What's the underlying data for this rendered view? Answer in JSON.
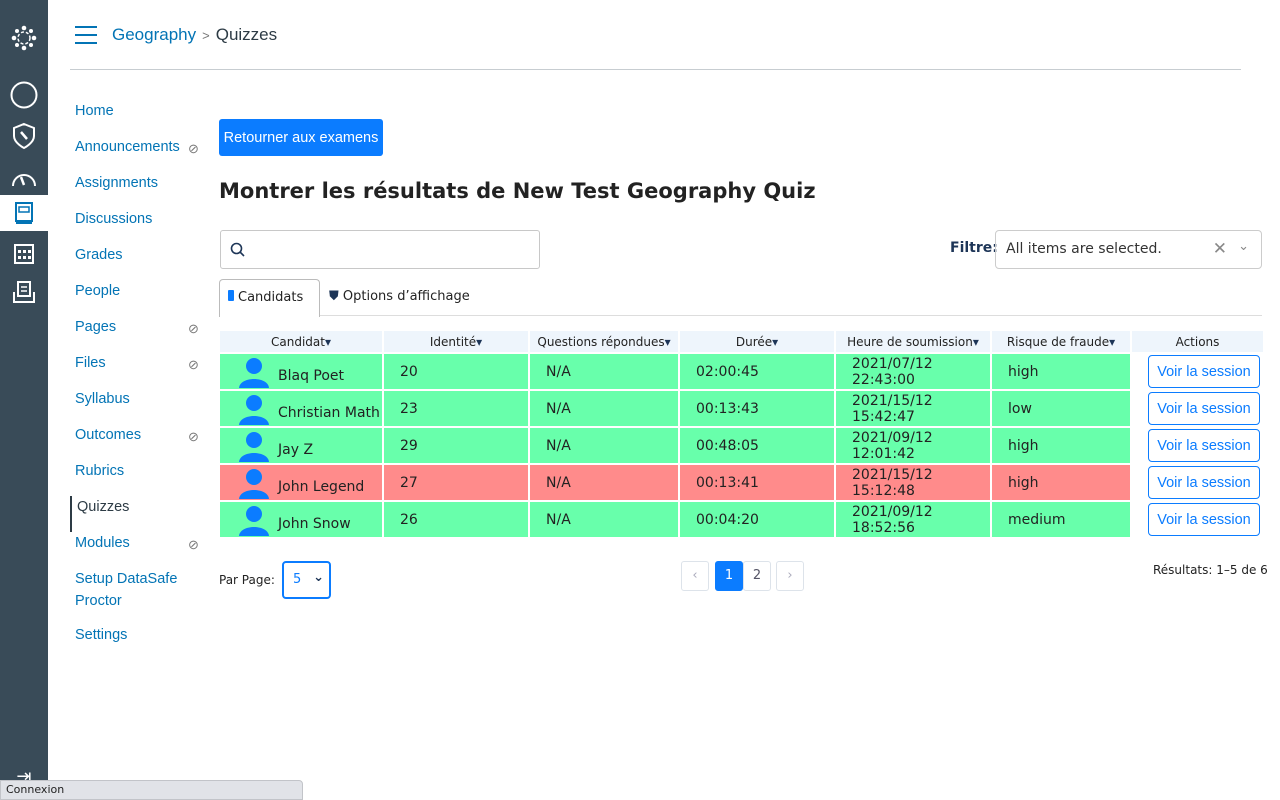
{
  "breadcrumb": {
    "course": "Geography",
    "page": "Quizzes"
  },
  "nav": [
    "Home",
    "Announcements",
    "Assignments",
    "Discussions",
    "Grades",
    "People",
    "Pages",
    "Files",
    "Syllabus",
    "Outcomes",
    "Rubrics",
    "Quizzes",
    "Modules",
    "Setup DataSafe Proctor",
    "Settings"
  ],
  "nav_hidden": [
    "Announcements",
    "Pages",
    "Files",
    "Outcomes",
    "Modules"
  ],
  "nav_current": "Quizzes",
  "back_button": "Retourner aux examens",
  "title": "Montrer les résultats de New Test Geography Quiz",
  "search": {
    "value": "",
    "placeholder": ""
  },
  "filter": {
    "label": "Filtre:",
    "value": "All items are selected."
  },
  "tabs": [
    "Candidats",
    "Options d’affichage"
  ],
  "table": {
    "headers": [
      "Candidat",
      "Identité",
      "Questions répondues",
      "Durée",
      "Heure de soumission",
      "Risque de fraude",
      "Actions"
    ],
    "action_label": "Voir la session",
    "rows": [
      {
        "name": "Blaq Poet",
        "id": "20",
        "questions": "N/A",
        "duration": "02:00:45",
        "submitted": "2021/07/12 22:43:00",
        "risk": "high",
        "flagged": false
      },
      {
        "name": "Christian Math",
        "id": "23",
        "questions": "N/A",
        "duration": "00:13:43",
        "submitted": "2021/15/12 15:42:47",
        "risk": "low",
        "flagged": false
      },
      {
        "name": "Jay Z",
        "id": "29",
        "questions": "N/A",
        "duration": "00:48:05",
        "submitted": "2021/09/12 12:01:42",
        "risk": "high",
        "flagged": false
      },
      {
        "name": "John Legend",
        "id": "27",
        "questions": "N/A",
        "duration": "00:13:41",
        "submitted": "2021/15/12 15:12:48",
        "risk": "high",
        "flagged": true
      },
      {
        "name": "John Snow",
        "id": "26",
        "questions": "N/A",
        "duration": "00:04:20",
        "submitted": "2021/09/12 18:52:56",
        "risk": "medium",
        "flagged": false
      }
    ]
  },
  "per_page": {
    "label": "Par Page:",
    "value": "5"
  },
  "pagination": {
    "pages": [
      "1",
      "2"
    ],
    "current": "1",
    "prev": "‹",
    "next": "›"
  },
  "results": "Résultats:  1–5 de 6",
  "status_bar": "Connexion",
  "colors": {
    "accent": "#0b7cff",
    "ok_row": "#68ffab",
    "flagged_row": "#ff8b8b",
    "rail": "#394b58"
  }
}
